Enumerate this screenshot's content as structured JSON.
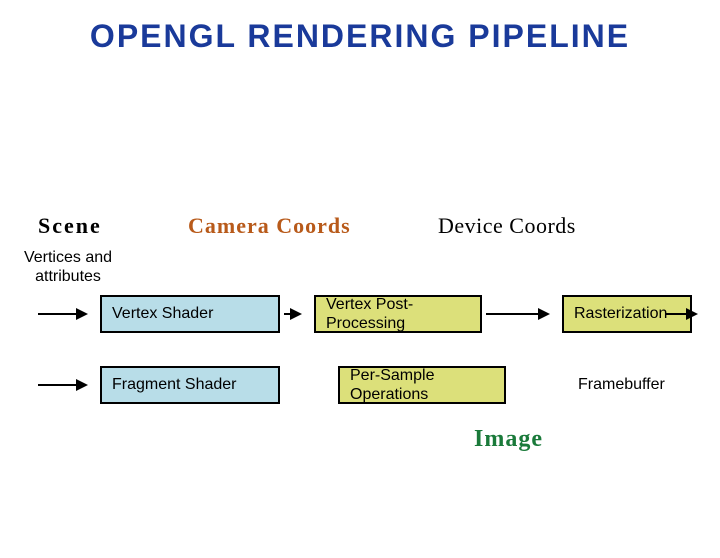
{
  "title": "OPENGL RENDERING PIPELINE",
  "labels": {
    "scene": "Scene",
    "camera": "Camera Coords",
    "device": "Device Coords",
    "image": "Image"
  },
  "sublabel": {
    "vertices_attrs": "Vertices and attributes"
  },
  "stages": {
    "vertex_shader": "Vertex Shader",
    "vertex_post_processing": "Vertex Post-Processing",
    "rasterization": "Rasterization",
    "fragment_shader": "Fragment Shader",
    "per_sample_ops": "Per-Sample Operations",
    "framebuffer": "Framebuffer"
  },
  "colors": {
    "title": "#1a3a9a",
    "camera_label": "#b85a1a",
    "image_label": "#1a7a3a",
    "stage_blue": "#b8dde8",
    "stage_yellow": "#dce07a"
  }
}
